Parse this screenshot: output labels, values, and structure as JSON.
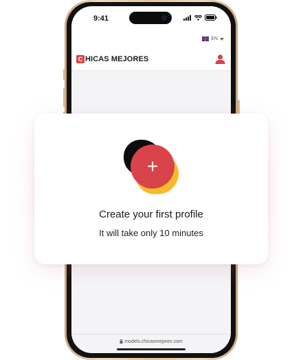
{
  "status_bar": {
    "time": "9:41"
  },
  "header": {
    "language": "EN",
    "logo_initial": "C",
    "logo_text": "HICAS MEJORES"
  },
  "card": {
    "title": "Create your first profile",
    "subtitle": "It will take only 10 minutes",
    "add_button_symbol": "+"
  },
  "browser": {
    "url": "models.chicasmejores.com"
  },
  "colors": {
    "brand_red": "#d9434a",
    "accent_yellow": "#f7bb2a",
    "phone_gold": "#e4c39f"
  },
  "icons": [
    "signal-icon",
    "wifi-icon",
    "battery-icon",
    "uk-flag-icon",
    "caret-down-icon",
    "user-icon",
    "lock-icon"
  ]
}
